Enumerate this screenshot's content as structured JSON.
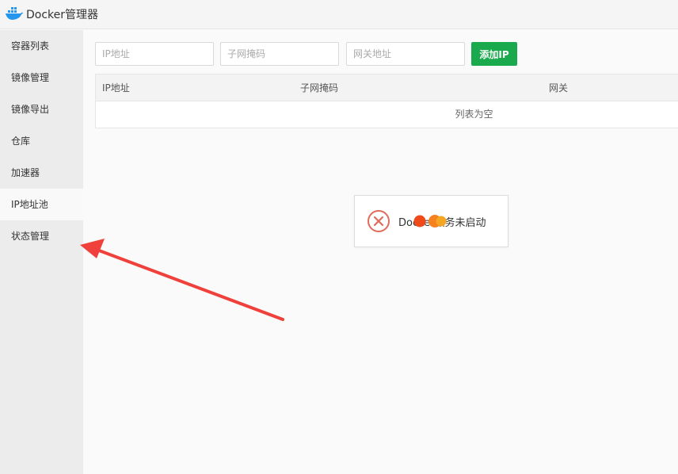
{
  "app": {
    "title": "Docker管理器",
    "logo_icon": "docker-whale-icon",
    "logo_color": "#2496ed"
  },
  "sidebar": {
    "active_index": 5,
    "items": [
      {
        "label": "容器列表"
      },
      {
        "label": "镜像管理"
      },
      {
        "label": "镜像导出"
      },
      {
        "label": "仓库"
      },
      {
        "label": "加速器"
      },
      {
        "label": "IP地址池"
      },
      {
        "label": "状态管理"
      }
    ]
  },
  "toolbar": {
    "ip_placeholder": "IP地址",
    "mask_placeholder": "子网掩码",
    "gateway_placeholder": "网关地址",
    "add_label": "添加IP",
    "add_color": "#1aa94c"
  },
  "table": {
    "headers": [
      "IP地址",
      "子网掩码",
      "网关"
    ],
    "empty_text": "列表为空"
  },
  "toast": {
    "text": "Docker服务未启动",
    "icon": "error-x-icon",
    "icon_color": "#e06b5b"
  },
  "annotation": {
    "arrow_color": "#f0403c"
  }
}
